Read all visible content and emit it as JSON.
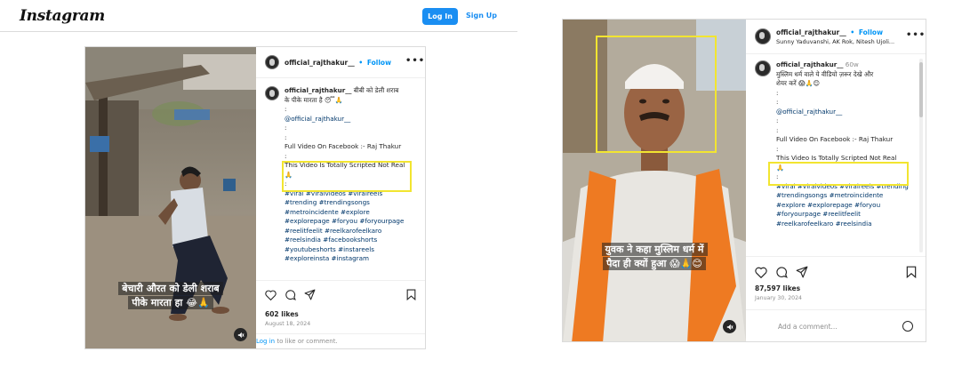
{
  "header": {
    "logo": "Instagram",
    "login_label": "Log In",
    "signup_label": "Sign Up"
  },
  "post1": {
    "username": "official_rajthakur__",
    "follow_dot": "•",
    "follow_label": "Follow",
    "more": "•••",
    "caption_username": "official_rajthakur__",
    "caption_line1": "बीबी को डेली शराब",
    "caption_line2": "के पीके मारता है 😴🙏",
    "colon": ":",
    "mention": "@official_rajthakur__",
    "full_video": "Full Video On Facebook :- Raj Thakur",
    "scripted": "This Video Is Totally Scripted Not Real",
    "scripted_emoji": "🙏",
    "hashtags": [
      "#viral #viralvideos #viralreels",
      "#trending #trendingsongs",
      "#metroincidente #explore",
      "#explorepage #foryou #foryourpage",
      "#reelitfeelit #reelkarofeelkaro",
      "#reelsindia #facebookshorts",
      "#youtubeshorts #instareels",
      "#exploreinsta #instagram"
    ],
    "likes": "602 likes",
    "date": "August 18, 2024",
    "footer_link": "Log in",
    "footer_text": " to like or comment.",
    "overlay_line1": "बेचारी औरत को डेली शराब",
    "overlay_line2": "पीके मारता हा 😂🙏"
  },
  "post2": {
    "username": "official_rajthakur__",
    "follow_dot": "•",
    "follow_label": "Follow",
    "subtitle": "Sunny Yaduvanshi, AK Rok, Nitesh Ujoli...",
    "more": "•••",
    "caption_username": "official_rajthakur__",
    "time_ago": "60w",
    "caption_line1": "मुस्लिम धर्म वाले ये वीडियो ज़रूर देखे और",
    "caption_line2": "शेयर करें 😱🙏😊",
    "colon": ":",
    "mention": "@official_rajthakur__",
    "full_video": "Full Video On Facebook :- Raj Thakur",
    "scripted": "This Video Is Totally Scripted Not Real",
    "scripted_emoji": "🙏",
    "hashtags": [
      "#viral #viralvideos #viralreels #trending",
      "#trendingsongs #metroincidente",
      "#explore #explorepage #foryou",
      "#foryourpage #reelitfeelit",
      "#reelkarofeelkaro #reelsindia"
    ],
    "likes": "87,597 likes",
    "date": "January 30, 2024",
    "comment_placeholder": "Add a comment...",
    "overlay_line1": "युवक ने कहा मुस्लिम धर्म में",
    "overlay_line2": "पैदा ही क्यों हुआ 😱🙏😊"
  },
  "colors": {
    "accent": "#0095f6",
    "login_bg": "#1a8ef2",
    "highlight": "#f2e530"
  }
}
